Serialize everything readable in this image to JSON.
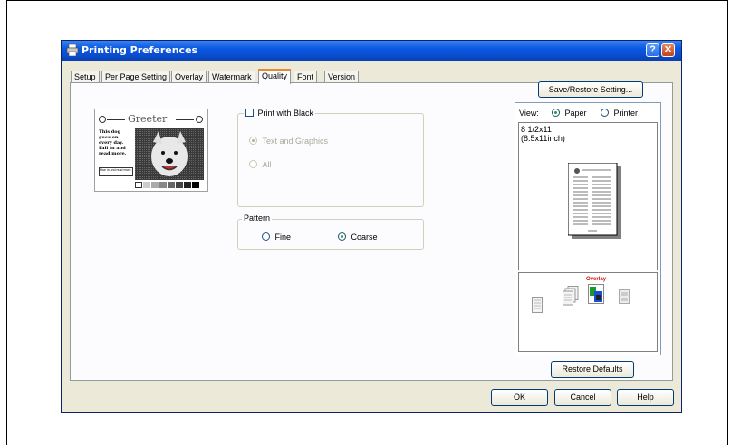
{
  "window": {
    "title": "Printing Preferences",
    "help_label": "?",
    "close_label": "✕"
  },
  "tabs": [
    "Setup",
    "Per Page Setting",
    "Overlay",
    "Watermark",
    "Quality",
    "Font",
    "Version"
  ],
  "active_tab": "Quality",
  "save_restore_label": "Save/Restore Setting...",
  "print_with_black": {
    "label": "Print with Black",
    "checked": false,
    "options": [
      {
        "label": "Text and Graphics",
        "selected": true,
        "enabled": false
      },
      {
        "label": "All",
        "selected": false,
        "enabled": false
      }
    ]
  },
  "pattern": {
    "legend": "Pattern",
    "options": [
      {
        "label": "Fine",
        "selected": false
      },
      {
        "label": "Coarse",
        "selected": true
      }
    ]
  },
  "preview_image": {
    "heading": "Greeter",
    "body_text": "This dog goes on every day. Fall in and read more.",
    "caption": "Rise in and read more."
  },
  "view": {
    "label": "View:",
    "options": [
      {
        "label": "Paper",
        "selected": true
      },
      {
        "label": "Printer",
        "selected": false
      }
    ],
    "paper_size_line1": "8 1/2x11",
    "paper_size_line2": "(8.5x11inch)",
    "overlay_label": "Overlay"
  },
  "restore_defaults_label": "Restore Defaults",
  "footer": {
    "ok": "OK",
    "cancel": "Cancel",
    "help": "Help"
  },
  "colors": {
    "title_bar": "#0a58e0",
    "tab_highlight": "#e68b2c",
    "radio_dot": "#21a121",
    "overlay_text": "#d01010"
  }
}
